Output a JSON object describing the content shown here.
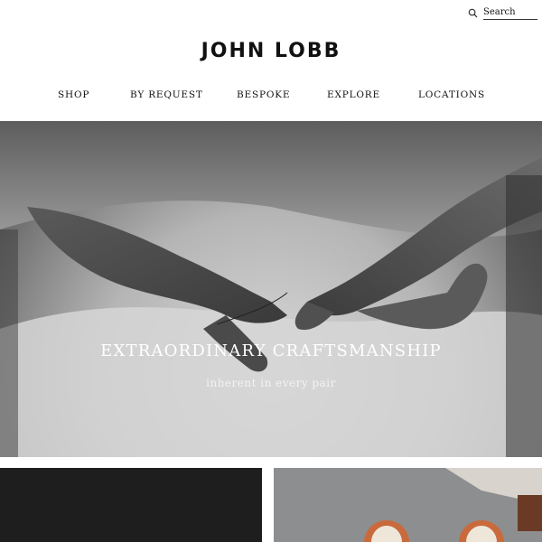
{
  "header": {
    "search": {
      "placeholder": "Search",
      "icon": "search-icon"
    },
    "logo": "JOHN LOBB"
  },
  "nav": {
    "items": [
      {
        "label": "SHOP"
      },
      {
        "label": "BY REQUEST"
      },
      {
        "label": "BESPOKE"
      },
      {
        "label": "EXPLORE"
      },
      {
        "label": "LOCATIONS"
      }
    ]
  },
  "hero": {
    "title": "EXTRAORDINARY CRAFTSMANSHIP",
    "subtitle": "inherent in every pair"
  },
  "colors": {
    "text": "#111111",
    "background": "#ffffff",
    "hero_text": "#ffffff"
  }
}
